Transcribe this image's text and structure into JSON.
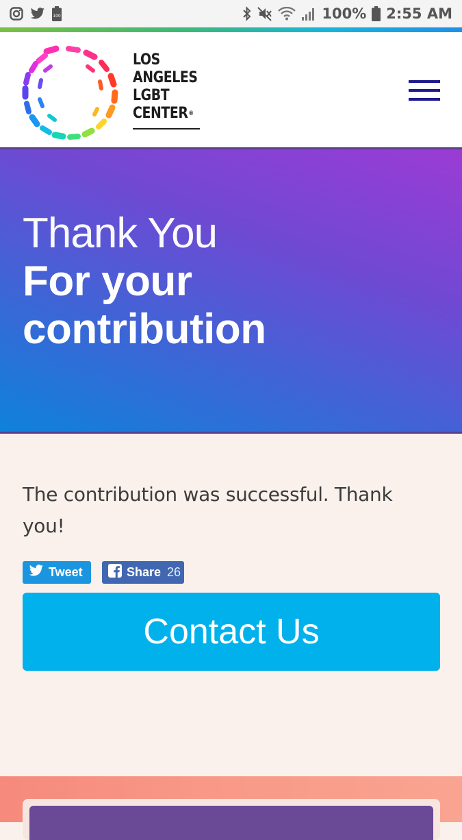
{
  "status_bar": {
    "battery_percent": "100%",
    "time": "2:55 AM",
    "left_icons": [
      "instagram-icon",
      "twitter-icon",
      "battery-saver-icon"
    ],
    "right_icons": [
      "bluetooth-icon",
      "mute-icon",
      "wifi-icon",
      "signal-icon",
      "battery-icon"
    ]
  },
  "header": {
    "logo_lines": [
      "LOS",
      "ANGELES",
      "LGBT",
      "CENTER"
    ],
    "logo_mark": "®",
    "menu_icon": "hamburger-menu-icon"
  },
  "hero": {
    "title_light": "Thank You",
    "title_bold": "For your contribution"
  },
  "content": {
    "message": "The contribution was successful. Thank you!",
    "tweet_label": "Tweet",
    "share_label": "Share",
    "share_count": "26",
    "contact_label": "Contact Us"
  },
  "colors": {
    "hero_start": "#0e82da",
    "hero_end": "#9b3bd4",
    "contact_button": "#00b1ec",
    "tweet_button": "#1b95e0",
    "share_button": "#4267b2",
    "menu_icon": "#1f1b8f",
    "footer_band": "#f68a7c",
    "footer_card_inner": "#6a4996"
  }
}
